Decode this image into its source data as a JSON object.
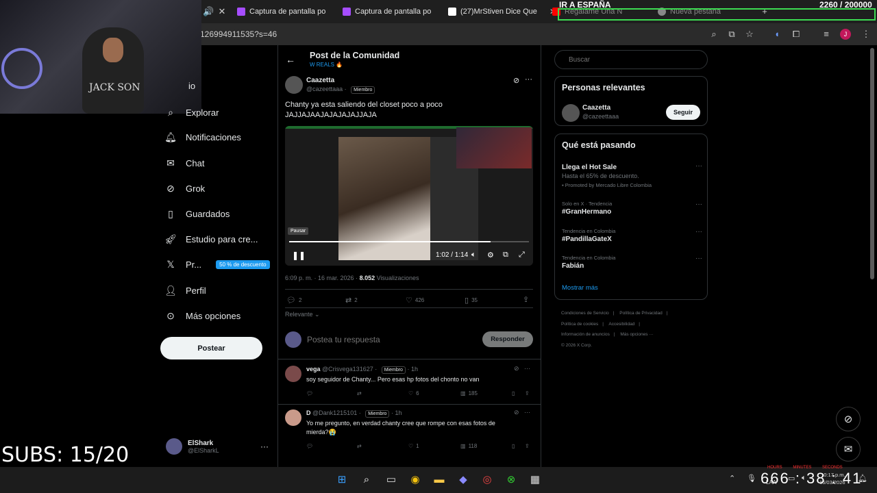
{
  "browser": {
    "tabs": [
      {
        "title": "Captura de pantalla po",
        "favicon_color": "#a64dff"
      },
      {
        "title": "Captura de pantalla po",
        "favicon_color": "#a64dff"
      },
      {
        "title": "(27)MrStiven Dice Que",
        "favicon_color": "#ffffff"
      },
      {
        "title": "Regálame Una N",
        "favicon_color": "#ff0000"
      },
      {
        "title": "Nueva pestaña",
        "favicon_color": "#888888"
      }
    ],
    "url": "126994911535?s=46",
    "profile_initial": "J"
  },
  "stream": {
    "banner": "IR A ESPAÑA",
    "counter": "2260   / 200000",
    "subs": "SUBS: 15/20",
    "timer": "666 : 38 : 41",
    "timer_labels": "HOURS MINUTES SECONDS",
    "shirt_text": "JACK SON"
  },
  "sidebar": {
    "items": [
      {
        "label": "Inicio",
        "icon": "home-icon",
        "visible_label": "io"
      },
      {
        "label": "Explorar",
        "icon": "search-icon"
      },
      {
        "label": "Notificaciones",
        "icon": "bell-icon"
      },
      {
        "label": "Chat",
        "icon": "mail-icon"
      },
      {
        "label": "Grok",
        "icon": "grok-icon"
      },
      {
        "label": "Guardados",
        "icon": "bookmark-icon"
      },
      {
        "label": "Estudio para cre...",
        "icon": "rocket-icon"
      },
      {
        "label": "Pr...",
        "icon": "x-logo-icon",
        "badge": "50 % de descuento"
      },
      {
        "label": "Perfil",
        "icon": "person-icon"
      },
      {
        "label": "Más opciones",
        "icon": "more-circle-icon"
      }
    ],
    "post_button": "Postear",
    "account": {
      "name": "ElShark",
      "handle": "@ElSharkL"
    }
  },
  "header": {
    "title": "Post de la Comunidad",
    "subtitle": "W REALS 🔥"
  },
  "post": {
    "author": "Caazetta",
    "handle": "@cazeettaaa",
    "badge": "Miembro",
    "text_line1": "Chanty ya esta saliendo del closet poco a poco",
    "text_line2": "JAJJAJAAJAJAJAJAJJAJA",
    "video": {
      "pause_tooltip": "Pausar",
      "time": "1:02 / 1:14",
      "progress": 0.84
    },
    "meta_time": "6:09 p. m. · 16 mar. 2026 · ",
    "views_count": "8.052",
    "views_label": " Visualizaciones",
    "replies": "2",
    "reposts": "2",
    "likes": "426",
    "bookmarks": "35",
    "sort_label": "Relevante"
  },
  "reply_box": {
    "placeholder": "Postea tu respuesta",
    "button": "Responder"
  },
  "replies": [
    {
      "name": "vega",
      "handle": "@Crisvega131627",
      "badge": "Miembro",
      "time": "· 1h",
      "text": "soy seguidor de Chanty... Pero esas hp fotos del chonto no van",
      "likes": "6",
      "views": "185"
    },
    {
      "name": "D",
      "handle": "@Dank1215101",
      "badge": "Miembro",
      "time": "· 1h",
      "text": "Yo me pregunto, en verdad chanty cree que rompe con esas fotos de mierda?😭",
      "likes": "1",
      "views": "118"
    }
  ],
  "right": {
    "search_placeholder": "Buscar",
    "relevant_title": "Personas relevantes",
    "relevant_person": {
      "name": "Caazetta",
      "handle": "@cazeettaaa",
      "button": "Seguir"
    },
    "trends_title": "Qué está pasando",
    "trends": [
      {
        "context": "",
        "title": "Llega el Hot Sale",
        "sub": "Hasta el 65% de descuento.",
        "promo": "Promoted by Mercado Libre Colombia"
      },
      {
        "context": "Solo en X · Tendencia",
        "title": "#GranHermano"
      },
      {
        "context": "Tendencia en Colombia",
        "title": "#PandillaGateX"
      },
      {
        "context": "Tendencia en Colombia",
        "title": "Fabián"
      }
    ],
    "show_more": "Mostrar más",
    "footer": [
      "Condiciones de Servicio",
      "|",
      "Política de Privacidad",
      "|",
      "Política de cookies",
      "|",
      "Accesibilidad",
      "|",
      "Información de anuncios",
      "|",
      "Más opciones ···",
      "© 2026 X Corp."
    ]
  },
  "taskbar": {
    "lang": "LAA",
    "time": "10:17 p.m.",
    "date": "16/03/2026"
  },
  "colors": {
    "accent": "#1d9bf0",
    "border": "#2f3336",
    "muted": "#71767b"
  }
}
